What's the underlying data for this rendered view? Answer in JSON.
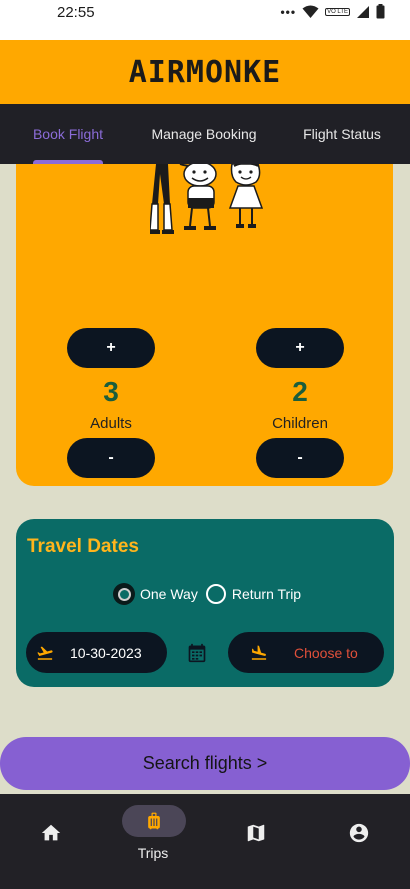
{
  "status_bar": {
    "time": "22:55",
    "icons": [
      "more-dots-icon",
      "wifi-icon",
      "volte-badge",
      "signal-icon",
      "battery-icon"
    ],
    "volte_text": "VO LTE"
  },
  "header": {
    "logo_text": "AIRMONKE"
  },
  "tabs": [
    {
      "label": "Book Flight",
      "active": true
    },
    {
      "label": "Manage Booking",
      "active": false
    },
    {
      "label": "Flight Status",
      "active": false
    }
  ],
  "passengers": {
    "adults": {
      "count": "3",
      "label": "Adults"
    },
    "children": {
      "count": "2",
      "label": "Children"
    },
    "increment_label": "+",
    "decrement_label": "-"
  },
  "travel_dates": {
    "title": "Travel Dates",
    "trip_options": [
      {
        "label": "One Way",
        "selected": true
      },
      {
        "label": "Return Trip",
        "selected": false
      }
    ],
    "from_date": "10-30-2023",
    "to_placeholder": "Choose to"
  },
  "search": {
    "label": "Search flights >"
  },
  "bottom_nav": [
    {
      "icon": "home-icon",
      "label": ""
    },
    {
      "icon": "luggage-icon",
      "label": "Trips",
      "active": true
    },
    {
      "icon": "map-icon",
      "label": ""
    },
    {
      "icon": "account-icon",
      "label": ""
    }
  ],
  "colors": {
    "header": "#ffa800",
    "tab_bar": "#202026",
    "tab_active": "#8b6cd8",
    "dates_card": "#0a6b66",
    "dates_title": "#ffb51c",
    "count_green": "#1b5e3c",
    "choose_to_red": "#e0503a",
    "search_button": "#8660d2",
    "background": "#ddddc9"
  }
}
